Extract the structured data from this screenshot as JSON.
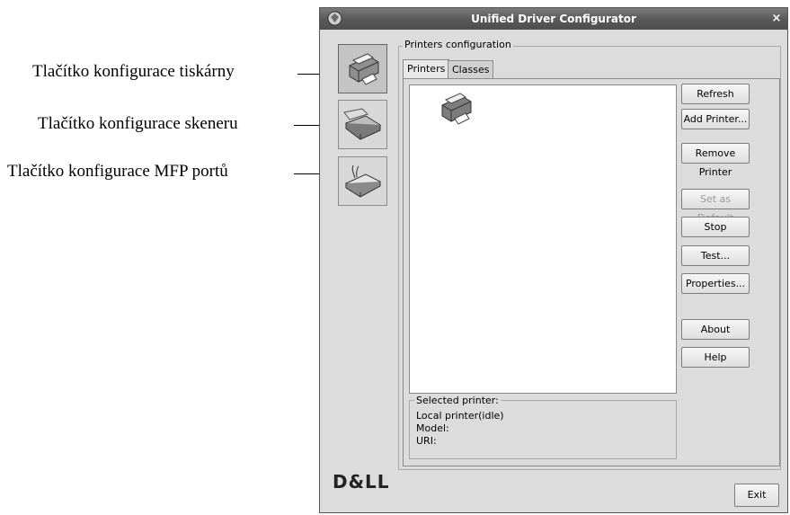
{
  "callouts": [
    "Tlačítko konfigurace tiskárny",
    "Tlačítko konfigurace skeneru",
    "Tlačítko konfigurace MFP portů"
  ],
  "window": {
    "title": "Unified Driver Configurator",
    "close_glyph": "×"
  },
  "sidebar": {
    "items": [
      {
        "icon": "printer-icon"
      },
      {
        "icon": "scanner-icon"
      },
      {
        "icon": "mfp-port-icon"
      }
    ]
  },
  "main": {
    "group_title": "Printers configuration",
    "tabs": [
      {
        "label": "Printers"
      },
      {
        "label": "Classes"
      }
    ],
    "buttons": [
      {
        "label": "Refresh"
      },
      {
        "label": "Add Printer..."
      },
      {
        "label": "Remove Printer"
      },
      {
        "label": "Set as Default",
        "disabled": true
      },
      {
        "label": "Stop"
      },
      {
        "label": "Test..."
      },
      {
        "label": "Properties..."
      },
      {
        "label": "About"
      },
      {
        "label": "Help"
      }
    ],
    "selected": {
      "title": "Selected printer:",
      "lines": [
        "Local printer(idle)",
        "Model:",
        "URI:"
      ]
    }
  },
  "footer": {
    "logo": "D&LL",
    "exit_label": "Exit"
  }
}
